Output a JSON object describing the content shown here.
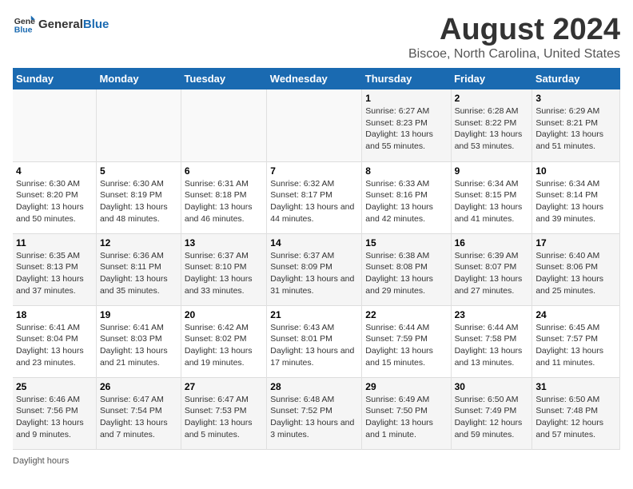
{
  "logo": {
    "general": "General",
    "blue": "Blue"
  },
  "title": "August 2024",
  "subtitle": "Biscoe, North Carolina, United States",
  "footer_label": "Daylight hours",
  "weekdays": [
    "Sunday",
    "Monday",
    "Tuesday",
    "Wednesday",
    "Thursday",
    "Friday",
    "Saturday"
  ],
  "weeks": [
    [
      {
        "day": "",
        "info": ""
      },
      {
        "day": "",
        "info": ""
      },
      {
        "day": "",
        "info": ""
      },
      {
        "day": "",
        "info": ""
      },
      {
        "day": "1",
        "info": "Sunrise: 6:27 AM\nSunset: 8:23 PM\nDaylight: 13 hours and 55 minutes."
      },
      {
        "day": "2",
        "info": "Sunrise: 6:28 AM\nSunset: 8:22 PM\nDaylight: 13 hours and 53 minutes."
      },
      {
        "day": "3",
        "info": "Sunrise: 6:29 AM\nSunset: 8:21 PM\nDaylight: 13 hours and 51 minutes."
      }
    ],
    [
      {
        "day": "4",
        "info": "Sunrise: 6:30 AM\nSunset: 8:20 PM\nDaylight: 13 hours and 50 minutes."
      },
      {
        "day": "5",
        "info": "Sunrise: 6:30 AM\nSunset: 8:19 PM\nDaylight: 13 hours and 48 minutes."
      },
      {
        "day": "6",
        "info": "Sunrise: 6:31 AM\nSunset: 8:18 PM\nDaylight: 13 hours and 46 minutes."
      },
      {
        "day": "7",
        "info": "Sunrise: 6:32 AM\nSunset: 8:17 PM\nDaylight: 13 hours and 44 minutes."
      },
      {
        "day": "8",
        "info": "Sunrise: 6:33 AM\nSunset: 8:16 PM\nDaylight: 13 hours and 42 minutes."
      },
      {
        "day": "9",
        "info": "Sunrise: 6:34 AM\nSunset: 8:15 PM\nDaylight: 13 hours and 41 minutes."
      },
      {
        "day": "10",
        "info": "Sunrise: 6:34 AM\nSunset: 8:14 PM\nDaylight: 13 hours and 39 minutes."
      }
    ],
    [
      {
        "day": "11",
        "info": "Sunrise: 6:35 AM\nSunset: 8:13 PM\nDaylight: 13 hours and 37 minutes."
      },
      {
        "day": "12",
        "info": "Sunrise: 6:36 AM\nSunset: 8:11 PM\nDaylight: 13 hours and 35 minutes."
      },
      {
        "day": "13",
        "info": "Sunrise: 6:37 AM\nSunset: 8:10 PM\nDaylight: 13 hours and 33 minutes."
      },
      {
        "day": "14",
        "info": "Sunrise: 6:37 AM\nSunset: 8:09 PM\nDaylight: 13 hours and 31 minutes."
      },
      {
        "day": "15",
        "info": "Sunrise: 6:38 AM\nSunset: 8:08 PM\nDaylight: 13 hours and 29 minutes."
      },
      {
        "day": "16",
        "info": "Sunrise: 6:39 AM\nSunset: 8:07 PM\nDaylight: 13 hours and 27 minutes."
      },
      {
        "day": "17",
        "info": "Sunrise: 6:40 AM\nSunset: 8:06 PM\nDaylight: 13 hours and 25 minutes."
      }
    ],
    [
      {
        "day": "18",
        "info": "Sunrise: 6:41 AM\nSunset: 8:04 PM\nDaylight: 13 hours and 23 minutes."
      },
      {
        "day": "19",
        "info": "Sunrise: 6:41 AM\nSunset: 8:03 PM\nDaylight: 13 hours and 21 minutes."
      },
      {
        "day": "20",
        "info": "Sunrise: 6:42 AM\nSunset: 8:02 PM\nDaylight: 13 hours and 19 minutes."
      },
      {
        "day": "21",
        "info": "Sunrise: 6:43 AM\nSunset: 8:01 PM\nDaylight: 13 hours and 17 minutes."
      },
      {
        "day": "22",
        "info": "Sunrise: 6:44 AM\nSunset: 7:59 PM\nDaylight: 13 hours and 15 minutes."
      },
      {
        "day": "23",
        "info": "Sunrise: 6:44 AM\nSunset: 7:58 PM\nDaylight: 13 hours and 13 minutes."
      },
      {
        "day": "24",
        "info": "Sunrise: 6:45 AM\nSunset: 7:57 PM\nDaylight: 13 hours and 11 minutes."
      }
    ],
    [
      {
        "day": "25",
        "info": "Sunrise: 6:46 AM\nSunset: 7:56 PM\nDaylight: 13 hours and 9 minutes."
      },
      {
        "day": "26",
        "info": "Sunrise: 6:47 AM\nSunset: 7:54 PM\nDaylight: 13 hours and 7 minutes."
      },
      {
        "day": "27",
        "info": "Sunrise: 6:47 AM\nSunset: 7:53 PM\nDaylight: 13 hours and 5 minutes."
      },
      {
        "day": "28",
        "info": "Sunrise: 6:48 AM\nSunset: 7:52 PM\nDaylight: 13 hours and 3 minutes."
      },
      {
        "day": "29",
        "info": "Sunrise: 6:49 AM\nSunset: 7:50 PM\nDaylight: 13 hours and 1 minute."
      },
      {
        "day": "30",
        "info": "Sunrise: 6:50 AM\nSunset: 7:49 PM\nDaylight: 12 hours and 59 minutes."
      },
      {
        "day": "31",
        "info": "Sunrise: 6:50 AM\nSunset: 7:48 PM\nDaylight: 12 hours and 57 minutes."
      }
    ]
  ]
}
